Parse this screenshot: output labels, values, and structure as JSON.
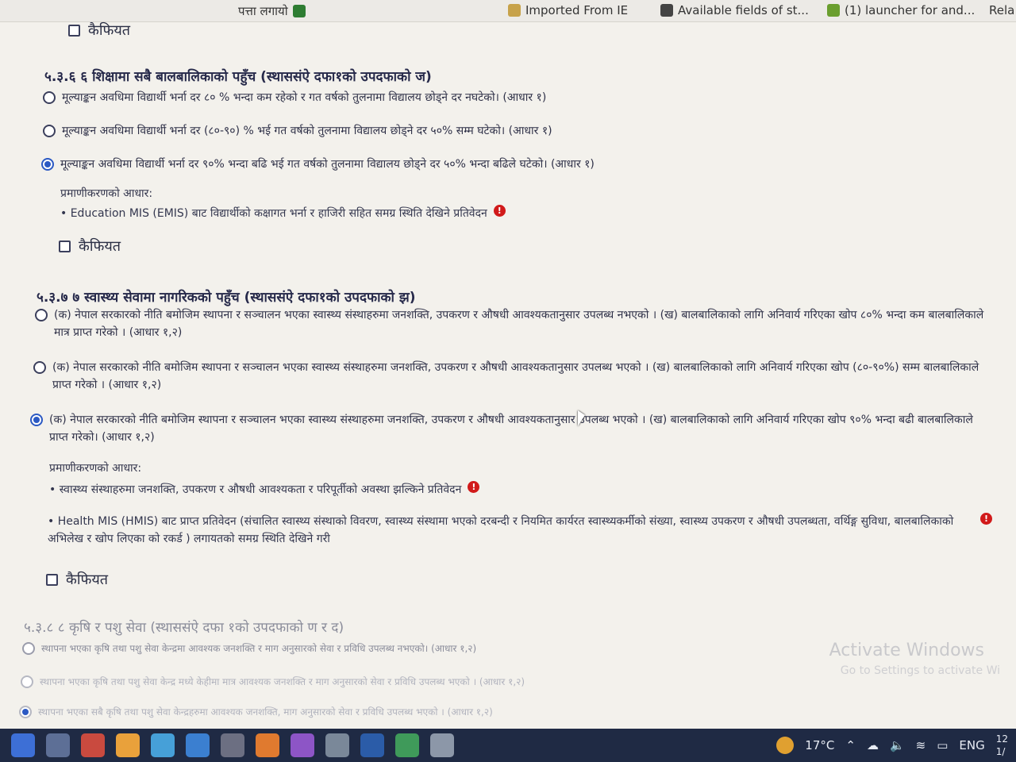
{
  "bookmarks": [
    {
      "label": "पत्ता लगायो",
      "icon": "check-circle-icon"
    },
    {
      "label": "Imported From IE",
      "icon": "folder-icon"
    },
    {
      "label": "Available fields of st...",
      "icon": "gear-icon"
    },
    {
      "label": "(1) launcher for and...",
      "icon": "leaf-icon"
    },
    {
      "label": "Rela",
      "icon": ""
    }
  ],
  "remark_label": "कैफियत",
  "sections": [
    {
      "title": "५.३.६ ६ शिक्षामा सबै बालबालिकाको पहुँच (स्थाससंऐ दफा१को उपदफाको ज)",
      "options": [
        "मूल्याङ्कन अवधिमा विद्यार्थी भर्ना दर ८० % भन्दा कम रहेको र गत वर्षको तुलनामा विद्यालय छोड्ने दर नघटेको। (आधार १)",
        "मूल्याङ्कन अवधिमा विद्यार्थी भर्ना दर (८०-९०) % भई गत वर्षको तुलनामा विद्यालय छोड्ने दर ५०% सम्म घटेको। (आधार १)",
        "मूल्याङ्कन अवधिमा विद्यार्थी भर्ना दर ९०% भन्दा बढि भई गत वर्षको तुलनामा विद्यालय छोड्ने दर ५०% भन्दा बढिले घटेको। (आधार १)"
      ],
      "selected": 2,
      "verification_label": "प्रमाणीकरणको आधार:",
      "verification_items": [
        "• Education MIS (EMIS) बाट विद्यार्थीको कक्षागत भर्ना र हाजिरी सहित समग्र स्थिति देखिने प्रतिवेदन"
      ]
    },
    {
      "title": "५.३.७ ७ स्वास्थ्य सेवामा नागरिकको पहुँच (स्थाससंऐ दफा१को उपदफाको झ)",
      "options": [
        "(क) नेपाल सरकारको नीति बमोजिम स्थापना र सञ्चालन भएका स्वास्थ्य संस्थाहरुमा जनशक्ति, उपकरण र औषधी आवश्यकतानुसार उपलब्ध नभएको । (ख) बालबालिकाको लागि अनिवार्य गरिएका खोप ८०% भन्दा कम बालबालिकाले मात्र प्राप्त गरेको । (आधार १,२)",
        "(क) नेपाल सरकारको नीति बमोजिम स्थापना र सञ्चालन भएका स्वास्थ्य संस्थाहरुमा जनशक्ति, उपकरण र औषधी आवश्यकतानुसार उपलब्ध भएको । (ख) बालबालिकाको लागि अनिवार्य गरिएका खोप (८०-९०%) सम्म बालबालिकाले प्राप्त गरेको । (आधार १,२)",
        "(क) नेपाल सरकारको नीति बमोजिम स्थापना र सञ्चालन भएका स्वास्थ्य संस्थाहरुमा जनशक्ति, उपकरण र औषधी आवश्यकतानुसार उपलब्ध भएको । (ख) बालबालिकाको लागि अनिवार्य गरिएका खोप ९०% भन्दा बढी बालबालिकाले प्राप्त गरेको। (आधार १,२)"
      ],
      "selected": 2,
      "verification_label": "प्रमाणीकरणको आधार:",
      "verification_items": [
        "• स्वास्थ्य संस्थाहरुमा जनशक्ति, उपकरण र औषधी आवश्यकता र परिपूर्तीको अवस्था झल्किने प्रतिवेदन",
        "• Health MIS (HMIS) बाट प्राप्त प्रतिवेदन (संचालित स्वास्थ्य संस्थाको विवरण, स्वास्थ्य संस्थामा भएको दरबन्दी र नियमित कार्यरत स्वास्थ्यकर्मीको संख्या, स्वास्थ्य उपकरण र औषधी उपलब्धता, वर्थिङ्ग सुविधा, बालबालिकाको अभिलेख र खोप लिएका को रकर्ड ) लगायतको समग्र स्थिति देखिने गरी"
      ]
    },
    {
      "title": "५.३.८ ८ कृषि र पशु सेवा (स्थाससंऐ दफा १को उपदफाको ण र द)",
      "options": [
        "स्थापना भएका कृषि तथा पशु सेवा केन्द्रमा आवश्यक जनशक्ति र माग अनुसारको सेवा र प्रविधि उपलब्ध नभएको। (आधार १,२)",
        "स्थापना भएका कृषि तथा पशु सेवा केन्द्र मध्ये केहीमा मात्र आवश्यक जनशक्ति र माग अनुसारको सेवा र प्रविधि उपलब्ध भएको । (आधार १,२)",
        "स्थापना भएका सबै कृषि तथा पशु सेवा केन्द्रहरुमा आवश्यक जनशक्ति, माग अनुसारको सेवा र प्रविधि उपलब्ध भएको । (आधार १,२)"
      ],
      "selected": 2
    }
  ],
  "watermark": {
    "line1": "Activate Windows",
    "line2": "Go to Settings to activate Wi"
  },
  "taskbar": {
    "temperature": "17°C",
    "language": "ENG",
    "clock_top": "12",
    "clock_bottom": "1/"
  }
}
